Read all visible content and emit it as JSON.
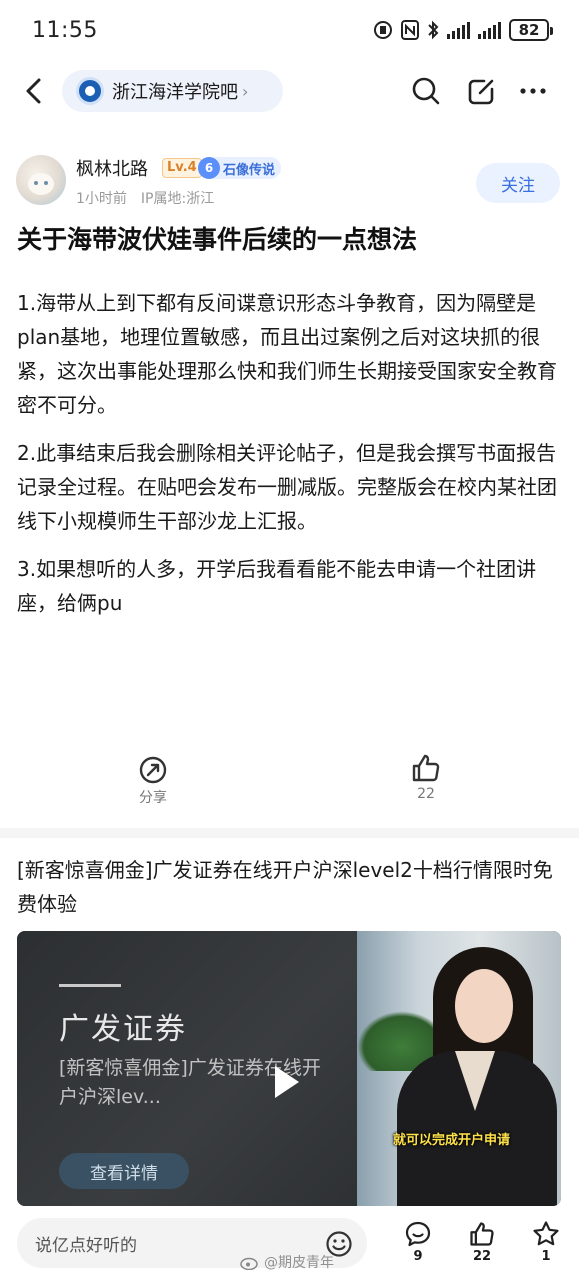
{
  "status_bar": {
    "time": "11:55",
    "battery": "82"
  },
  "nav": {
    "forum_name": "浙江海洋学院吧"
  },
  "author": {
    "name": "枫林北路",
    "level": "Lv.4",
    "title_num": "6",
    "title": "石像传说",
    "time": "1小时前",
    "ip": "IP属地:浙江",
    "follow_label": "关注"
  },
  "post": {
    "title": "关于海带波伏娃事件后续的一点想法",
    "paragraphs": [
      "1.海带从上到下都有反间谍意识形态斗争教育，因为隔壁是plan基地，地理位置敏感，而且出过案例之后对这块抓的很紧，这次出事能处理那么快和我们师生长期接受国家安全教育密不可分。",
      "2.此事结束后我会删除相关评论帖子，但是我会撰写书面报告记录全过程。在贴吧会发布一删减版。完整版会在校内某社团线下小规模师生干部沙龙上汇报。",
      "3.如果想听的人多，开学后我看看能不能去申请一个社团讲座，给俩pu"
    ],
    "share_label": "分享",
    "like_count": "22"
  },
  "ad": {
    "title": "[新客惊喜佣金]广发证券在线开户沪深level2十档行情限时免费体验",
    "brand": "广发证券",
    "desc": "[新客惊喜佣金]广发证券在线开户沪深lev...",
    "details_label": "查看详情",
    "caption": "就可以完成开户申请"
  },
  "bottom_bar": {
    "comment_placeholder": "说亿点好听的",
    "comment_count": "9",
    "like_count": "22",
    "fav_count": "1"
  },
  "watermark": "@期皮青年"
}
